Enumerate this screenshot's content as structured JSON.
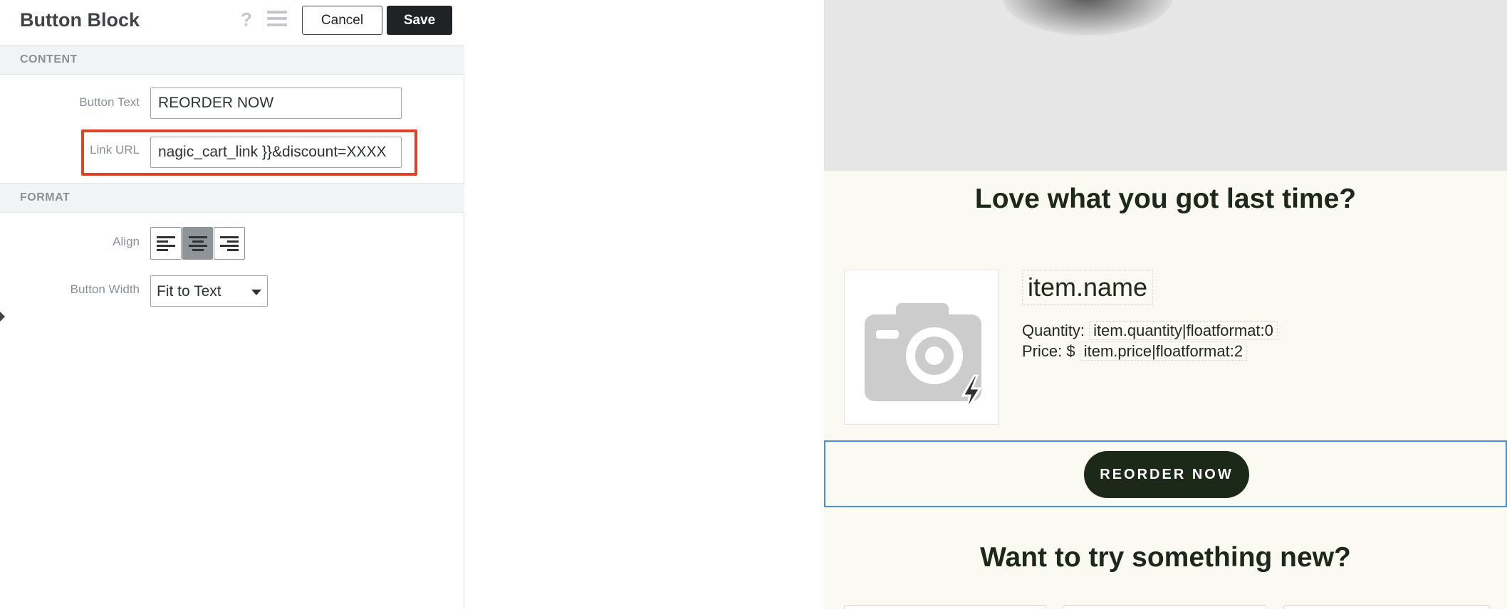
{
  "editor": {
    "title": "Button Block",
    "help_icon": "?",
    "menu_icon": "hamburger-icon",
    "cancel_label": "Cancel",
    "save_label": "Save",
    "content_section": "CONTENT",
    "format_section": "FORMAT",
    "button_text_label": "Button Text",
    "button_text_value": "REORDER NOW",
    "link_url_label": "Link URL",
    "link_url_value": "nagic_cart_link }}&discount=XXXX",
    "align_label": "Align",
    "align_options": [
      "align-left",
      "align-center",
      "align-right"
    ],
    "align_selected": "align-center",
    "button_width_label": "Button Width",
    "button_width_value": "Fit to Text",
    "highlight_color": "#e0432b"
  },
  "preview": {
    "heading_reorder": "Love what you got last time?",
    "item_name": "item.name",
    "quantity_label": "Quantity:",
    "quantity_value": "item.quantity|floatformat:0",
    "price_label": "Price: $",
    "price_value": "item.price|floatformat:2",
    "reorder_button": "REORDER NOW",
    "heading_new": "Want to try something new?",
    "background_color": "#faf9f2",
    "button_color": "#1c2918",
    "selection_color": "#4a90d0"
  }
}
